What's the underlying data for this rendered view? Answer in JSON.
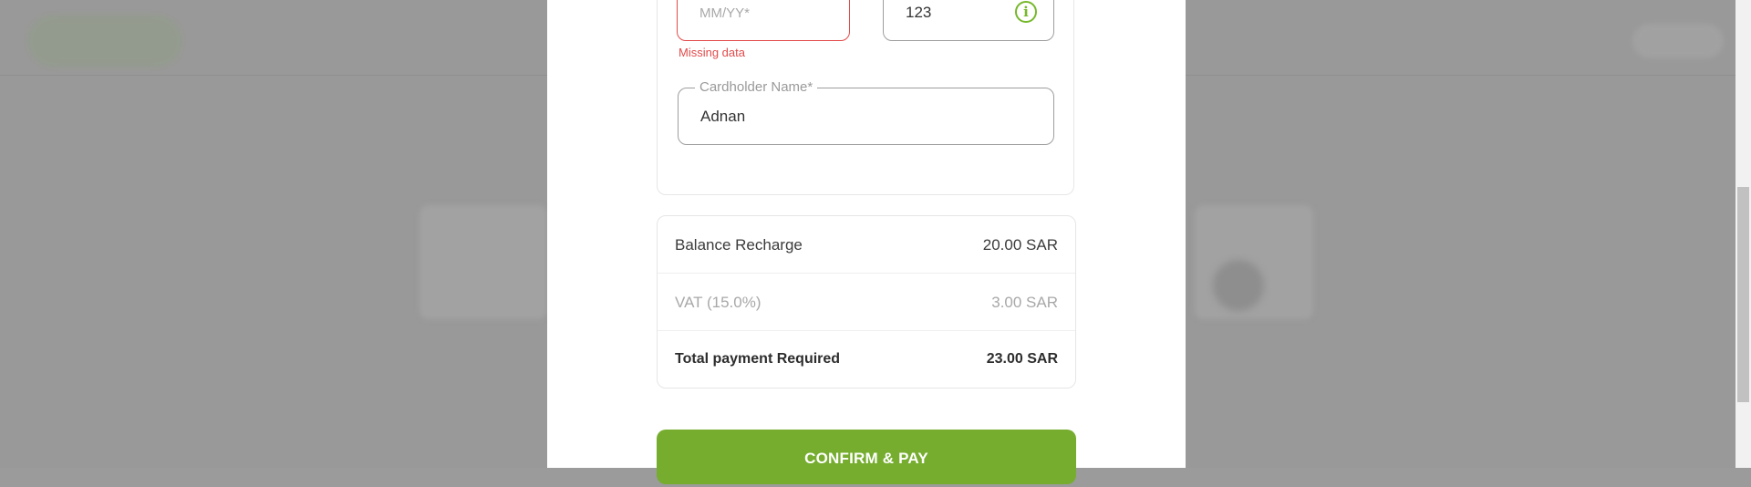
{
  "form": {
    "expiry": {
      "placeholder": "MM/YY*",
      "error": "Missing data"
    },
    "cvv": {
      "value": "123",
      "icon": "info-icon"
    },
    "cardholder": {
      "label": "Cardholder Name*",
      "value": "Adnan"
    }
  },
  "summary": {
    "rows": [
      {
        "label": "Balance Recharge",
        "amount": "20.00 SAR"
      },
      {
        "label": "VAT (15.0%)",
        "amount": "3.00 SAR"
      },
      {
        "label": "Total payment Required",
        "amount": "23.00 SAR"
      }
    ]
  },
  "actions": {
    "pay_label": "CONFIRM & PAY"
  },
  "colors": {
    "accent": "#76ad2f",
    "error": "#e24b4b",
    "overlay": "#999999"
  }
}
